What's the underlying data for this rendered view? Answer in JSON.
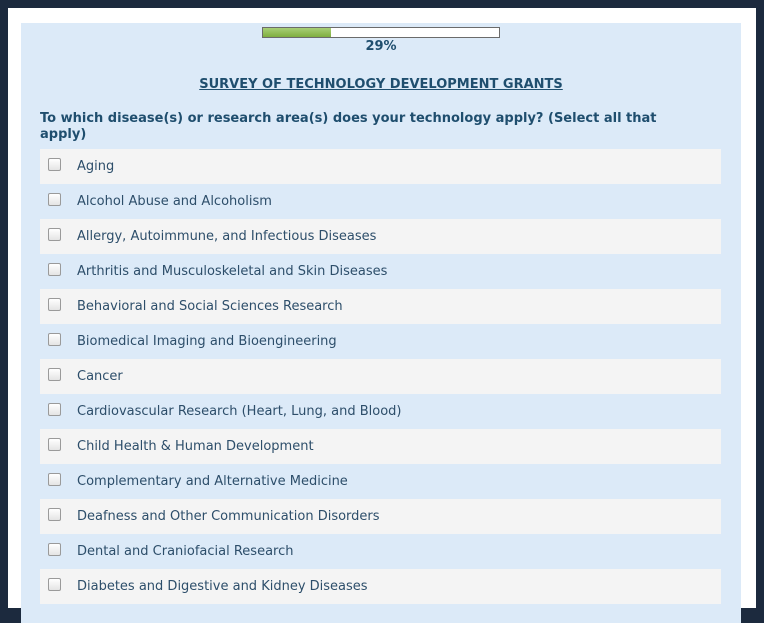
{
  "progress": {
    "percent_label": "29%",
    "fraction": 0.29,
    "fill_color": "#8dbd4f"
  },
  "survey": {
    "title": "SURVEY OF TECHNOLOGY DEVELOPMENT GRANTS",
    "question": "To which disease(s) or research area(s) does your technology apply? (Select all that apply)"
  },
  "options": [
    {
      "label": "Aging",
      "checked": false
    },
    {
      "label": "Alcohol Abuse and Alcoholism",
      "checked": false
    },
    {
      "label": "Allergy, Autoimmune, and Infectious Diseases",
      "checked": false
    },
    {
      "label": "Arthritis and Musculoskeletal and Skin Diseases",
      "checked": false
    },
    {
      "label": "Behavioral and Social Sciences Research",
      "checked": false
    },
    {
      "label": "Biomedical Imaging and Bioengineering",
      "checked": false
    },
    {
      "label": "Cancer",
      "checked": false
    },
    {
      "label": "Cardiovascular Research (Heart, Lung, and Blood)",
      "checked": false
    },
    {
      "label": "Child Health & Human Development",
      "checked": false
    },
    {
      "label": "Complementary and Alternative Medicine",
      "checked": false
    },
    {
      "label": "Deafness and Other Communication Disorders",
      "checked": false
    },
    {
      "label": "Dental and Craniofacial Research",
      "checked": false
    },
    {
      "label": "Diabetes and Digestive and Kidney Diseases",
      "checked": false
    }
  ],
  "colors": {
    "text": "#1f4e6e",
    "panel_bg": "#dceaf8",
    "row_shade": "#f4f4f4"
  }
}
